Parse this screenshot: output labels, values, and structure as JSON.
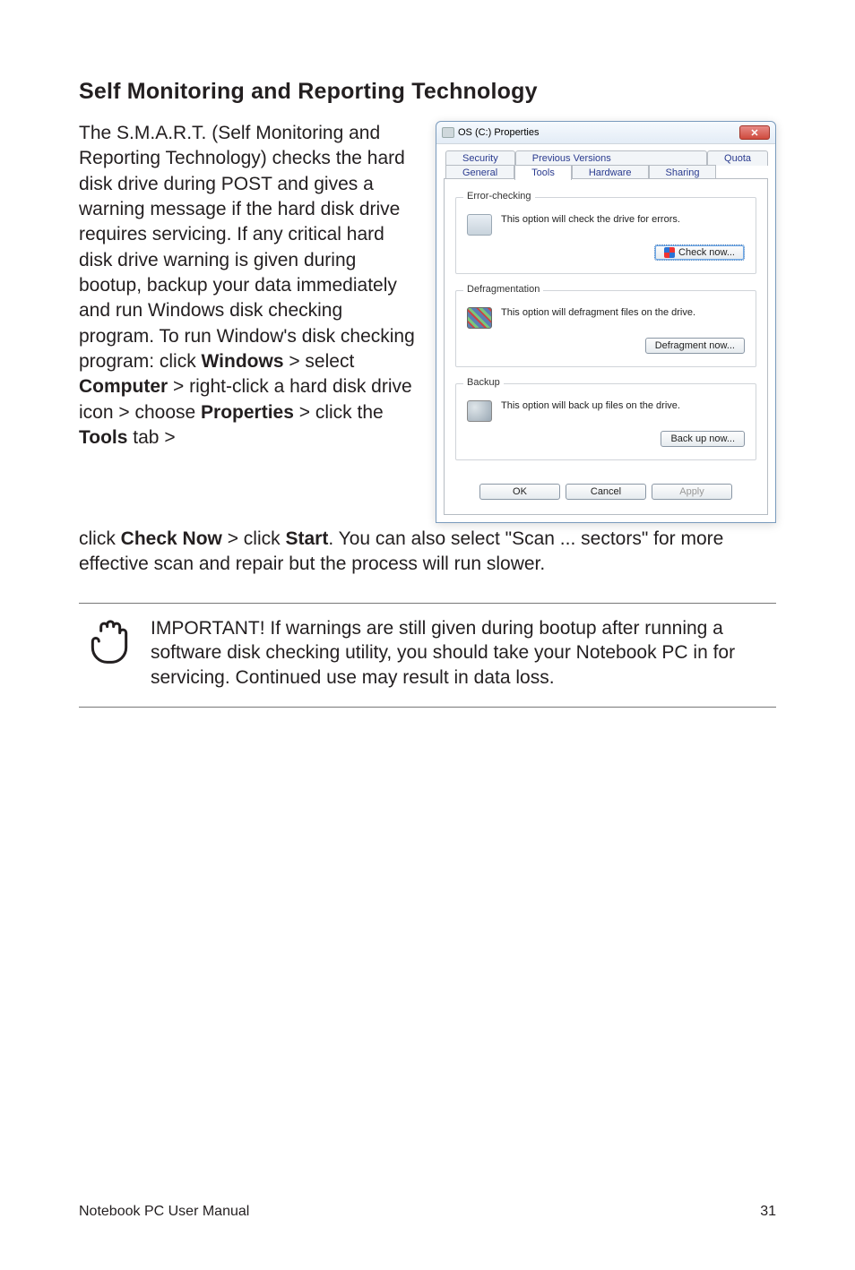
{
  "heading": "Self Monitoring and Reporting Technology",
  "body": {
    "intro_part1": "The S.M.A.R.T. (Self Monitoring and Reporting Technology) checks the hard disk drive during POST and gives a warning message if the hard disk drive requires servicing. If any critical hard disk drive warning is given during bootup, backup your data immediately and run Windows disk checking program. To run Window's disk checking program: click ",
    "windows_bold": "Windows",
    "intro_part2": " > select ",
    "computer_bold": "Computer",
    "intro_part3": " > right-click a hard disk drive icon > choose ",
    "properties_bold": "Properties",
    "intro_part4": " > click the ",
    "tools_bold": "Tools",
    "intro_part5": " tab > ",
    "cont_part1": "click ",
    "checknow_bold": "Check Now",
    "cont_part2": " > click ",
    "start_bold": "Start",
    "cont_part3": ". You can also select \"Scan ... sectors\" for more effective scan and repair but the process will run slower."
  },
  "window": {
    "title": "OS (C:) Properties",
    "close_glyph": "✕",
    "tabs_top": [
      "Security",
      "Previous Versions",
      "Quota"
    ],
    "tabs_bottom": [
      "General",
      "Tools",
      "Hardware",
      "Sharing"
    ],
    "active_tab": "Tools",
    "groups": {
      "error": {
        "label": "Error-checking",
        "text": "This option will check the drive for errors.",
        "button": "Check now..."
      },
      "defrag": {
        "label": "Defragmentation",
        "text": "This option will defragment files on the drive.",
        "button": "Defragment now..."
      },
      "backup": {
        "label": "Backup",
        "text": "This option will back up files on the drive.",
        "button": "Back up now..."
      }
    },
    "buttons": {
      "ok": "OK",
      "cancel": "Cancel",
      "apply": "Apply"
    }
  },
  "callout": {
    "text": "IMPORTANT! If warnings are still given during bootup after running a software disk checking utility, you should take your Notebook PC in for servicing. Continued use may result in data loss."
  },
  "footer": {
    "left": "Notebook PC User Manual",
    "right": "31"
  }
}
